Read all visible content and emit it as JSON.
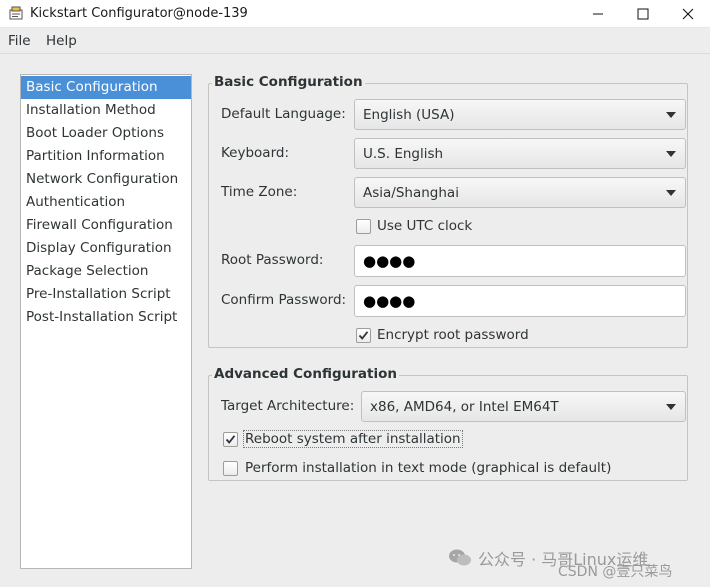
{
  "window": {
    "title": "Kickstart Configurator@node-139"
  },
  "menu": {
    "file": "File",
    "help": "Help"
  },
  "sidebar": {
    "items": [
      {
        "label": "Basic Configuration",
        "selected": true
      },
      {
        "label": "Installation Method"
      },
      {
        "label": "Boot Loader Options"
      },
      {
        "label": "Partition Information"
      },
      {
        "label": "Network Configuration"
      },
      {
        "label": "Authentication"
      },
      {
        "label": "Firewall Configuration"
      },
      {
        "label": "Display Configuration"
      },
      {
        "label": "Package Selection"
      },
      {
        "label": "Pre-Installation Script"
      },
      {
        "label": "Post-Installation Script"
      }
    ]
  },
  "basic": {
    "legend": "Basic Configuration",
    "language_label": "Default Language:",
    "language_value": "English (USA)",
    "keyboard_label": "Keyboard:",
    "keyboard_value": "U.S. English",
    "timezone_label": "Time Zone:",
    "timezone_value": "Asia/Shanghai",
    "utc_label": "Use UTC clock",
    "utc_checked": false,
    "root_password_label": "Root Password:",
    "root_password_value": "●●●●",
    "confirm_password_label": "Confirm Password:",
    "confirm_password_value": "●●●●",
    "encrypt_label": "Encrypt root password",
    "encrypt_checked": true
  },
  "advanced": {
    "legend": "Advanced Configuration",
    "arch_label": "Target Architecture:",
    "arch_value": "x86, AMD64, or Intel EM64T",
    "reboot_label": "Reboot system after installation",
    "reboot_checked": true,
    "textmode_label": "Perform installation in text mode (graphical is default)",
    "textmode_checked": false
  },
  "watermark": {
    "line1": "公众号 · 马哥Linux运维",
    "line2": "CSDN @壹只菜鸟"
  },
  "colors": {
    "selection": "#4a90d9",
    "window_bg": "#ededed"
  }
}
